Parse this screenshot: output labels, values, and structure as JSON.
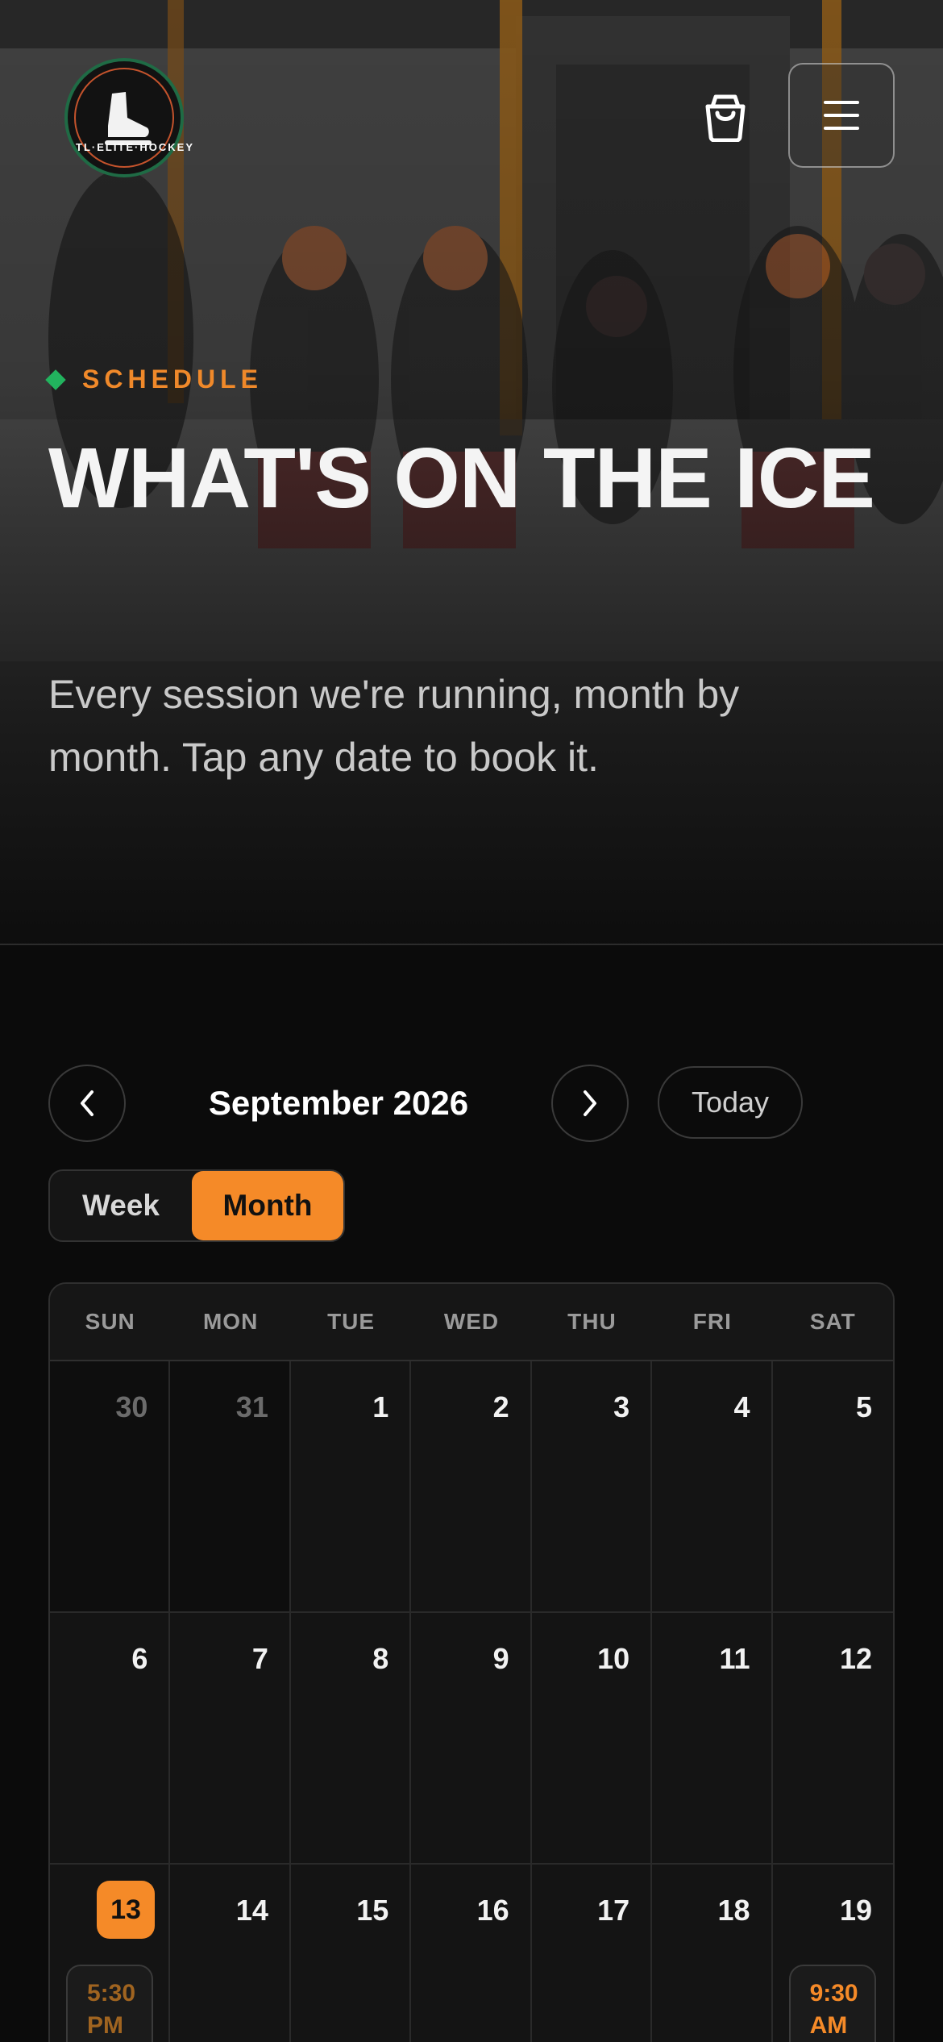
{
  "header": {
    "logo_text": "TL·ELITE·HOCKEY",
    "cart_icon": "shopping-bag-icon",
    "menu_icon": "hamburger-menu-icon"
  },
  "hero": {
    "eyebrow": "SCHEDULE",
    "title": "WHAT'S ON THE ICE",
    "subtitle": "Every session we're running, month by month. Tap any date to book it."
  },
  "calendar": {
    "month_label": "September 2026",
    "today_label": "Today",
    "views": {
      "week": "Week",
      "month": "Month",
      "selected": "Month"
    },
    "weekdays": [
      "SUN",
      "MON",
      "TUE",
      "WED",
      "THU",
      "FRI",
      "SAT"
    ],
    "days": [
      {
        "day": "30",
        "muted": true
      },
      {
        "day": "31",
        "muted": true
      },
      {
        "day": "1"
      },
      {
        "day": "2"
      },
      {
        "day": "3"
      },
      {
        "day": "4"
      },
      {
        "day": "5"
      },
      {
        "day": "6"
      },
      {
        "day": "7"
      },
      {
        "day": "8"
      },
      {
        "day": "9"
      },
      {
        "day": "10"
      },
      {
        "day": "11"
      },
      {
        "day": "12"
      },
      {
        "day": "13",
        "today": true,
        "event": {
          "time": "5:30 PM",
          "state": "past"
        }
      },
      {
        "day": "14"
      },
      {
        "day": "15"
      },
      {
        "day": "16"
      },
      {
        "day": "17"
      },
      {
        "day": "18"
      },
      {
        "day": "19",
        "event": {
          "time": "9:30 AM",
          "state": "upcoming"
        }
      }
    ]
  },
  "colors": {
    "accent": "#f58a28",
    "eyebrow_diamond": "#22b35e",
    "background": "#0b0b0b"
  }
}
